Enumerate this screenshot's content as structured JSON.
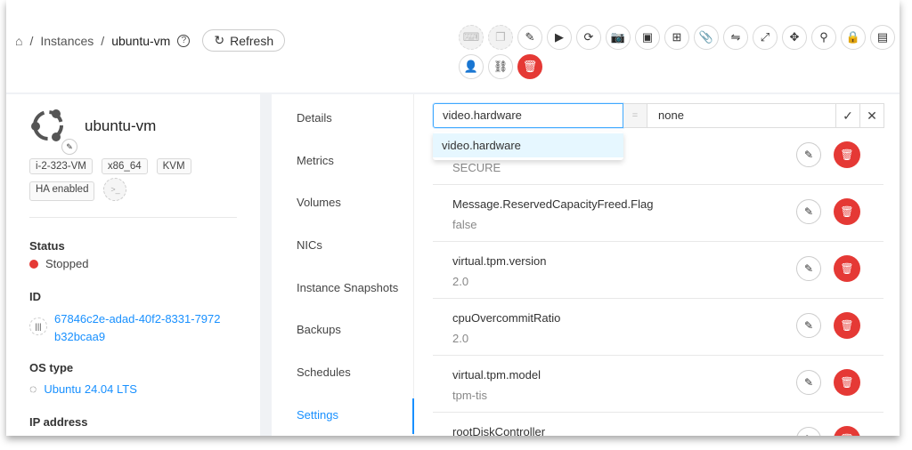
{
  "breadcrumb": {
    "home_icon": "home-icon",
    "instances": "Instances",
    "separator": "/",
    "current": "ubuntu-vm",
    "help": "?"
  },
  "refresh_label": "Refresh",
  "actions": [
    {
      "name": "console",
      "glyph": "⌨",
      "state": "disabled"
    },
    {
      "name": "copy",
      "glyph": "❐",
      "state": "disabled"
    },
    {
      "name": "edit",
      "glyph": "✎"
    },
    {
      "name": "start",
      "glyph": "▶"
    },
    {
      "name": "reinstall",
      "glyph": "⟳"
    },
    {
      "name": "snapshot",
      "glyph": "📷"
    },
    {
      "name": "backup",
      "glyph": "▣"
    },
    {
      "name": "attach-iso",
      "glyph": "⊞"
    },
    {
      "name": "attach",
      "glyph": "📎"
    },
    {
      "name": "migrate",
      "glyph": "⇋"
    },
    {
      "name": "scale",
      "glyph": "⤢"
    },
    {
      "name": "move",
      "glyph": "✥"
    },
    {
      "name": "search",
      "glyph": "⚲"
    },
    {
      "name": "reset-password",
      "glyph": "🔒"
    },
    {
      "name": "ssh-key",
      "glyph": "▤"
    },
    {
      "name": "assign-user",
      "glyph": "👤"
    },
    {
      "name": "unlink",
      "glyph": "⛓"
    },
    {
      "name": "destroy",
      "glyph": "🗑",
      "state": "danger"
    }
  ],
  "vm": {
    "name": "ubuntu-vm",
    "tags": [
      "i-2-323-VM",
      "x86_64",
      "KVM",
      "HA enabled"
    ],
    "status_label": "Status",
    "status": "Stopped",
    "status_color": "#e53935",
    "id_label": "ID",
    "id_line1": "67846c2e-adad-40f2-8331-7972",
    "id_line2": "b32bcaa9",
    "os_label": "OS type",
    "os": "Ubuntu 24.04 LTS",
    "ip_label": "IP address"
  },
  "tabs": [
    "Details",
    "Metrics",
    "Volumes",
    "NICs",
    "Instance Snapshots",
    "Backups",
    "Schedules",
    "Settings"
  ],
  "active_tab": "Settings",
  "editor": {
    "key": "video.hardware",
    "equals": "=",
    "value": "none",
    "suggestion": "video.hardware"
  },
  "settings": [
    {
      "key": "",
      "value": "SECURE"
    },
    {
      "key": "Message.ReservedCapacityFreed.Flag",
      "value": "false"
    },
    {
      "key": "virtual.tpm.version",
      "value": "2.0"
    },
    {
      "key": "cpuOvercommitRatio",
      "value": "2.0"
    },
    {
      "key": "virtual.tpm.model",
      "value": "tpm-tis"
    },
    {
      "key": "rootDiskController",
      "value": ""
    }
  ]
}
